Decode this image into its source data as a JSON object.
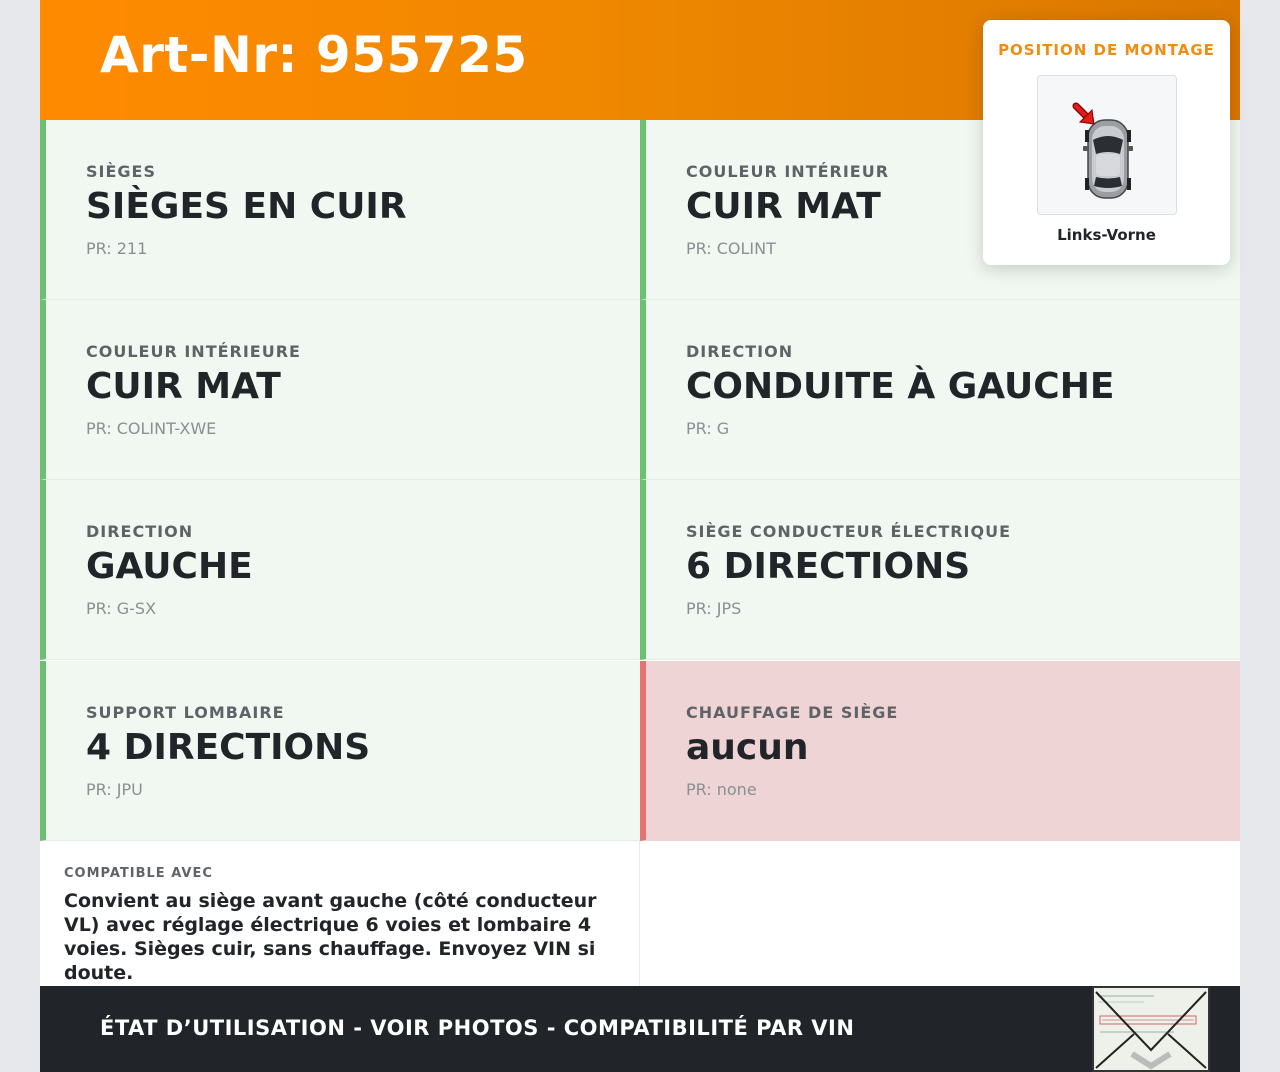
{
  "header": {
    "title": "Art-Nr: 955725"
  },
  "specs": [
    {
      "label": "SIÈGES",
      "value": "SIÈGES EN CUIR",
      "pr": "PR: 211",
      "status": "ok"
    },
    {
      "label": "COULEUR INTÉRIEUR",
      "value": "CUIR MAT",
      "pr": "PR: COLINT",
      "status": "ok"
    },
    {
      "label": "COULEUR INTÉRIEURE",
      "value": "CUIR MAT",
      "pr": "PR: COLINT-XWE",
      "status": "ok"
    },
    {
      "label": "DIRECTION",
      "value": "CONDUITE À GAUCHE",
      "pr": "PR: G",
      "status": "ok"
    },
    {
      "label": "DIRECTION",
      "value": "GAUCHE",
      "pr": "PR: G-SX",
      "status": "ok"
    },
    {
      "label": "SIÈGE CONDUCTEUR ÉLECTRIQUE",
      "value": "6 DIRECTIONS",
      "pr": "PR: JPS",
      "status": "ok"
    },
    {
      "label": "SUPPORT LOMBAIRE",
      "value": "4 DIRECTIONS",
      "pr": "PR: JPU",
      "status": "ok"
    },
    {
      "label": "CHAUFFAGE DE SIÈGE",
      "value": "aucun",
      "pr": "PR: none",
      "status": "missing"
    }
  ],
  "compat": {
    "label": "COMPATIBLE AVEC",
    "text": "Convient au siège avant gauche (côté conducteur VL) avec réglage électrique 6 voies et lombaire 4 voies. Sièges cuir, sans chauffage. Envoyez VIN si doute."
  },
  "position": {
    "title": "POSITION DE MONTAGE",
    "caption": "Links-Vorne",
    "icon": "car-top-view-icon"
  },
  "footer": {
    "text": "ÉTAT D’UTILISATION - VOIR PHOTOS - COMPATIBILITÉ PAR VIN"
  },
  "colors": {
    "header_orange": "#ff8a00",
    "ok_border": "#6cc070",
    "ok_bg": "#f1f8f1",
    "missing_border": "#e57373",
    "missing_bg": "#eed4d4",
    "footer_bg": "#212529",
    "position_title": "#f28c10"
  }
}
